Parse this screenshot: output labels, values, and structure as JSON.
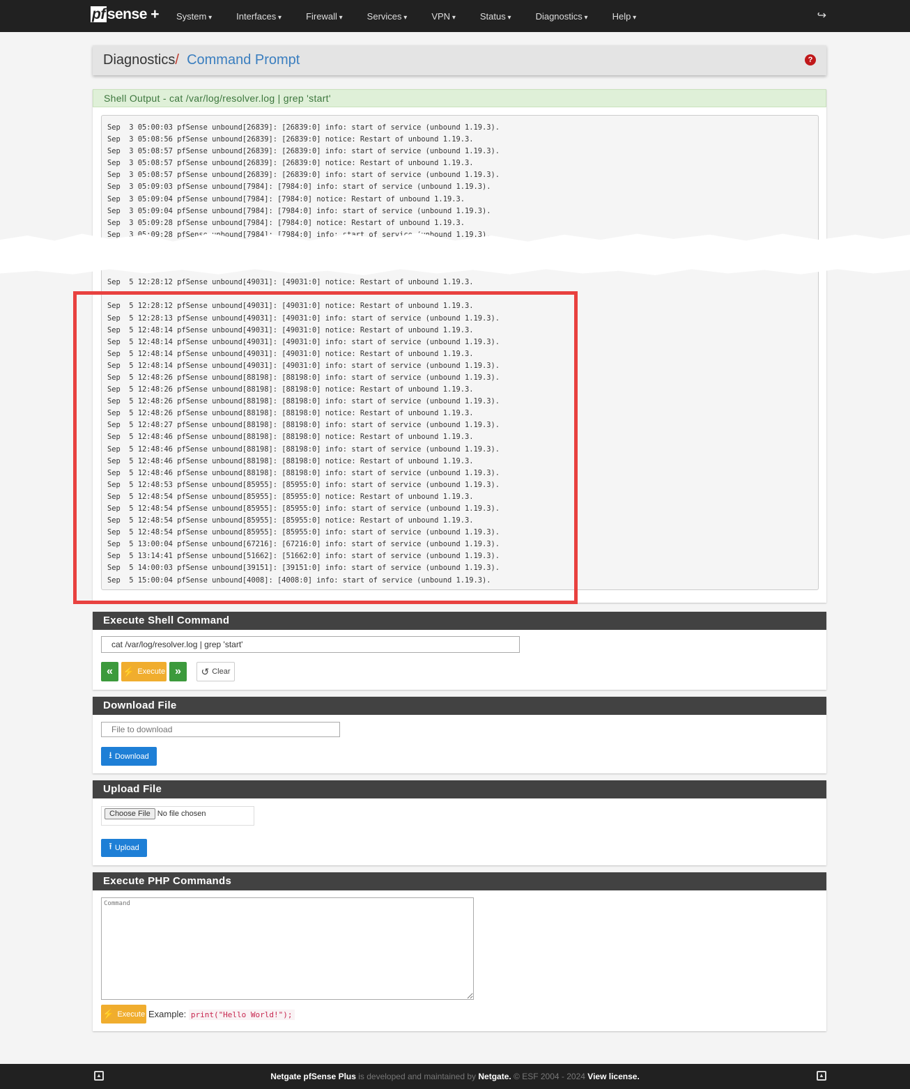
{
  "nav": {
    "logo": "sense",
    "logo_pf": "pf",
    "logo_plus": "+",
    "items": [
      "System",
      "Interfaces",
      "Firewall",
      "Services",
      "VPN",
      "Status",
      "Diagnostics",
      "Help"
    ]
  },
  "breadcrumb": {
    "parent": "Diagnostics",
    "separator": "/",
    "current": "Command Prompt"
  },
  "shell_output": {
    "title": "Shell Output - cat /var/log/resolver.log | grep 'start'",
    "lines_top": [
      "Sep  3 05:00:03 pfSense unbound[26839]: [26839:0] info: start of service (unbound 1.19.3).",
      "Sep  3 05:08:56 pfSense unbound[26839]: [26839:0] notice: Restart of unbound 1.19.3.",
      "Sep  3 05:08:57 pfSense unbound[26839]: [26839:0] info: start of service (unbound 1.19.3).",
      "Sep  3 05:08:57 pfSense unbound[26839]: [26839:0] notice: Restart of unbound 1.19.3.",
      "Sep  3 05:08:57 pfSense unbound[26839]: [26839:0] info: start of service (unbound 1.19.3).",
      "Sep  3 05:09:03 pfSense unbound[7984]: [7984:0] info: start of service (unbound 1.19.3).",
      "Sep  3 05:09:04 pfSense unbound[7984]: [7984:0] notice: Restart of unbound 1.19.3.",
      "Sep  3 05:09:04 pfSense unbound[7984]: [7984:0] info: start of service (unbound 1.19.3).",
      "Sep  3 05:09:28 pfSense unbound[7984]: [7984:0] notice: Restart of unbound 1.19.3.",
      "Sep  3 05:09:28 pfSense unbound[7984]: [7984:0] info: start of service (unbound 1.19.3)."
    ],
    "lines_after_tear": [
      "Sep  5 12:28:12 pfSense unbound[49031]: [49031:0] notice: Restart of unbound 1.19.3."
    ],
    "lines_highlighted": [
      "Sep  5 12:28:12 pfSense unbound[49031]: [49031:0] notice: Restart of unbound 1.19.3.",
      "Sep  5 12:28:13 pfSense unbound[49031]: [49031:0] info: start of service (unbound 1.19.3).",
      "Sep  5 12:48:14 pfSense unbound[49031]: [49031:0] notice: Restart of unbound 1.19.3.",
      "Sep  5 12:48:14 pfSense unbound[49031]: [49031:0] info: start of service (unbound 1.19.3).",
      "Sep  5 12:48:14 pfSense unbound[49031]: [49031:0] notice: Restart of unbound 1.19.3.",
      "Sep  5 12:48:14 pfSense unbound[49031]: [49031:0] info: start of service (unbound 1.19.3).",
      "Sep  5 12:48:26 pfSense unbound[88198]: [88198:0] info: start of service (unbound 1.19.3).",
      "Sep  5 12:48:26 pfSense unbound[88198]: [88198:0] notice: Restart of unbound 1.19.3.",
      "Sep  5 12:48:26 pfSense unbound[88198]: [88198:0] info: start of service (unbound 1.19.3).",
      "Sep  5 12:48:26 pfSense unbound[88198]: [88198:0] notice: Restart of unbound 1.19.3.",
      "Sep  5 12:48:27 pfSense unbound[88198]: [88198:0] info: start of service (unbound 1.19.3).",
      "Sep  5 12:48:46 pfSense unbound[88198]: [88198:0] notice: Restart of unbound 1.19.3.",
      "Sep  5 12:48:46 pfSense unbound[88198]: [88198:0] info: start of service (unbound 1.19.3).",
      "Sep  5 12:48:46 pfSense unbound[88198]: [88198:0] notice: Restart of unbound 1.19.3.",
      "Sep  5 12:48:46 pfSense unbound[88198]: [88198:0] info: start of service (unbound 1.19.3).",
      "Sep  5 12:48:53 pfSense unbound[85955]: [85955:0] info: start of service (unbound 1.19.3).",
      "Sep  5 12:48:54 pfSense unbound[85955]: [85955:0] notice: Restart of unbound 1.19.3.",
      "Sep  5 12:48:54 pfSense unbound[85955]: [85955:0] info: start of service (unbound 1.19.3).",
      "Sep  5 12:48:54 pfSense unbound[85955]: [85955:0] notice: Restart of unbound 1.19.3.",
      "Sep  5 12:48:54 pfSense unbound[85955]: [85955:0] info: start of service (unbound 1.19.3).",
      "Sep  5 13:00:04 pfSense unbound[67216]: [67216:0] info: start of service (unbound 1.19.3).",
      "Sep  5 13:14:41 pfSense unbound[51662]: [51662:0] info: start of service (unbound 1.19.3).",
      "Sep  5 14:00:03 pfSense unbound[39151]: [39151:0] info: start of service (unbound 1.19.3).",
      "Sep  5 15:00:04 pfSense unbound[4008]: [4008:0] info: start of service (unbound 1.19.3)."
    ]
  },
  "exec_shell": {
    "title": "Execute Shell Command",
    "command_value": "cat /var/log/resolver.log | grep 'start'",
    "execute": "Execute",
    "clear": "Clear"
  },
  "download": {
    "title": "Download File",
    "placeholder": "File to download",
    "button": "Download"
  },
  "upload": {
    "title": "Upload File",
    "choose": "Choose File",
    "no_file": "No file chosen",
    "button": "Upload"
  },
  "php": {
    "title": "Execute PHP Commands",
    "placeholder": "Command",
    "execute": "Execute",
    "example_label": "Example:",
    "example_code": "print(\"Hello World!\");"
  },
  "footer": {
    "brand": "Netgate pfSense Plus",
    "text1": " is developed and maintained by ",
    "company": "Netgate.",
    "text2": " © ESF 2004 - 2024 ",
    "license": "View license."
  },
  "colors": {
    "highlight_box": "#e8413f",
    "navbar": "#212121",
    "execute": "#f0ad2e",
    "nav_arrows": "#3c9a3c",
    "download": "#1e7fd6"
  }
}
